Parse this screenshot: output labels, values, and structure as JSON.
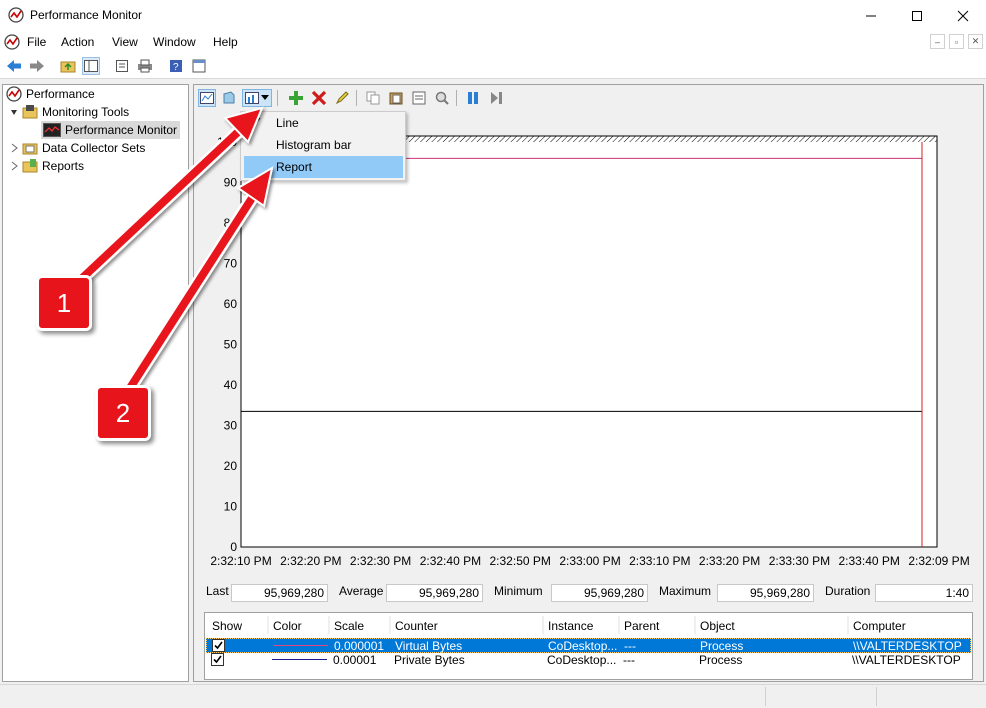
{
  "window": {
    "title": "Performance Monitor"
  },
  "menu": {
    "items": [
      "File",
      "Action",
      "View",
      "Window",
      "Help"
    ]
  },
  "tree": {
    "items": [
      {
        "label": "Performance"
      },
      {
        "label": "Monitoring Tools"
      },
      {
        "label": "Performance Monitor"
      },
      {
        "label": "Data Collector Sets"
      },
      {
        "label": "Reports"
      }
    ]
  },
  "graph": {
    "y_ticks": [
      "100",
      "90",
      "80",
      "70",
      "60",
      "50",
      "40",
      "30",
      "20",
      "10",
      "0"
    ],
    "x_ticks": [
      "2:32:10 PM",
      "2:32:20 PM",
      "2:32:30 PM",
      "2:32:40 PM",
      "2:32:50 PM",
      "2:33:00 PM",
      "2:33:10 PM",
      "2:33:20 PM",
      "2:33:30 PM",
      "2:33:40 PM",
      "2:32:09 PM"
    ]
  },
  "chart_data": {
    "type": "line",
    "x": [
      "2:32:10 PM",
      "2:32:20 PM",
      "2:32:30 PM",
      "2:32:40 PM",
      "2:32:50 PM",
      "2:33:00 PM",
      "2:33:10 PM",
      "2:33:20 PM",
      "2:33:30 PM",
      "2:33:40 PM",
      "2:32:09 PM"
    ],
    "ylim": [
      0,
      100
    ],
    "series": [
      {
        "values": [
          95.97,
          95.97,
          95.97,
          95.97,
          95.97,
          95.97,
          95.97,
          95.97,
          95.97,
          95.97,
          95.97
        ],
        "color": "#cc3377"
      },
      {
        "values": [
          33.5,
          33.5,
          33.5,
          33.5,
          33.5,
          33.5,
          33.5,
          33.5,
          33.5,
          33.5,
          33.5
        ],
        "color": "#000000"
      }
    ]
  },
  "stats": {
    "last_label": "Last",
    "last": "95,969,280",
    "average_label": "Average",
    "average": "95,969,280",
    "minimum_label": "Minimum",
    "minimum": "95,969,280",
    "maximum_label": "Maximum",
    "maximum": "95,969,280",
    "duration_label": "Duration",
    "duration": "1:40"
  },
  "legend": {
    "headers": [
      "Show",
      "Color",
      "Scale",
      "Counter",
      "Instance",
      "Parent",
      "Object",
      "Computer"
    ],
    "rows": [
      {
        "scale": "0.000001",
        "counter": "Virtual Bytes",
        "instance": "CoDesktop...",
        "parent": "---",
        "object": "Process",
        "computer": "\\\\VALTERDESKTOP",
        "color": "#e0457b"
      },
      {
        "scale": "0.00001",
        "counter": "Private Bytes",
        "instance": "CoDesktop...",
        "parent": "---",
        "object": "Process",
        "computer": "\\\\VALTERDESKTOP",
        "color": "#1a1a8c"
      }
    ]
  },
  "dropdown": {
    "items": [
      "Line",
      "Histogram bar",
      "Report"
    ]
  },
  "callouts": [
    "1",
    "2"
  ],
  "colors": {
    "accent": "#0078d7",
    "highlight": "#91c9f7",
    "callout": "#e8141c"
  }
}
